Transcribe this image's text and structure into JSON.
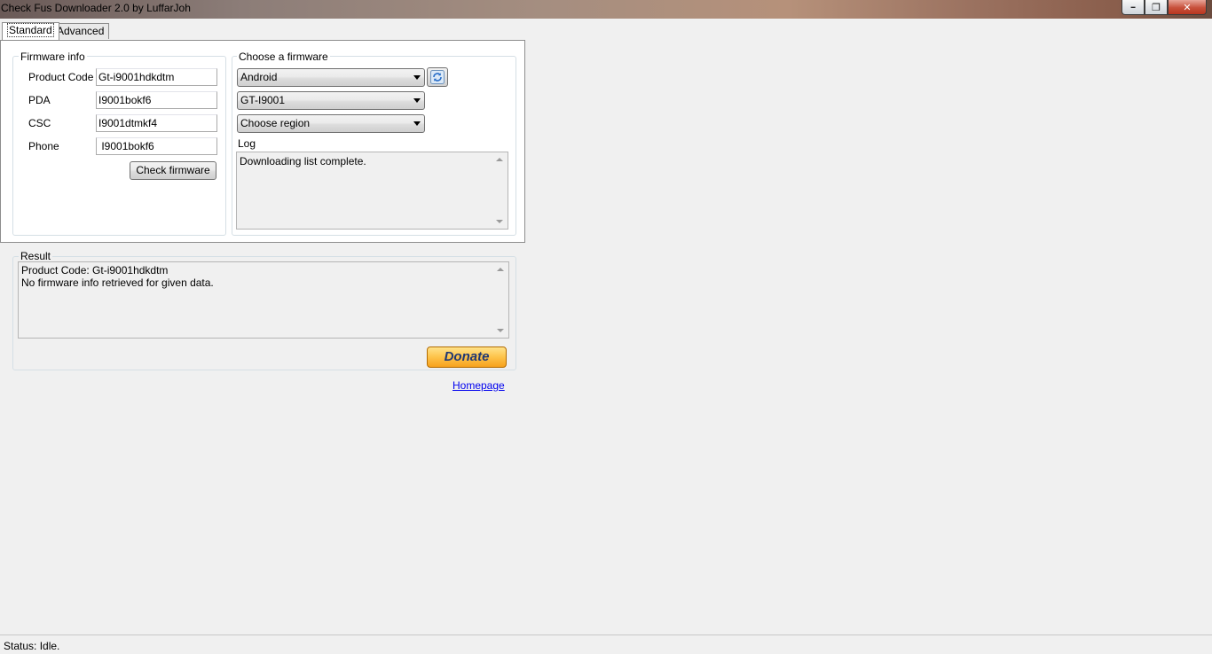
{
  "window": {
    "title": "Check Fus Downloader 2.0 by LuffarJoh",
    "minimize_glyph": "━",
    "maximize_glyph": "❐",
    "close_glyph": "✕"
  },
  "tabs": [
    {
      "label": "Standard",
      "active": true
    },
    {
      "label": "Advanced",
      "active": false
    }
  ],
  "firmware_info": {
    "legend": "Firmware info",
    "fields": [
      {
        "label": "Product Code",
        "value": "Gt-i9001hdkdtm"
      },
      {
        "label": "PDA",
        "value": "I9001bokf6"
      },
      {
        "label": "CSC",
        "value": "I9001dtmkf4"
      },
      {
        "label": "Phone",
        "value": " I9001bokf6"
      }
    ],
    "check_button": "Check firmware"
  },
  "choose_firmware": {
    "legend": "Choose a firmware",
    "os_select": "Android",
    "model_select": "GT-I9001",
    "region_select": "Choose region",
    "refresh_icon": "refresh-icon",
    "log_label": "Log",
    "log_text": "Downloading list complete."
  },
  "result": {
    "legend": "Result",
    "lines": [
      "Product Code: Gt-i9001hdkdtm",
      "No firmware info retrieved for given data."
    ],
    "donate_label": "Donate",
    "homepage_link": "Homepage"
  },
  "status": {
    "text": "Status: Idle."
  },
  "colors": {
    "donate_gradient_top": "#ffe28a",
    "donate_gradient_bottom": "#f7a11d",
    "donate_text": "#1e3774",
    "link": "#0000ee"
  }
}
